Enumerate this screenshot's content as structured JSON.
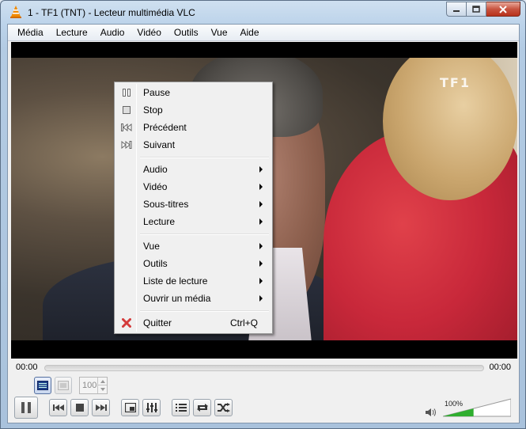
{
  "window": {
    "title": "1 - TF1 (TNT) - Lecteur multimédia VLC",
    "buttons": {
      "minimize": "minimize-icon",
      "maximize": "maximize-icon",
      "close": "close-icon"
    }
  },
  "menubar": {
    "items": [
      "Média",
      "Lecture",
      "Audio",
      "Vidéo",
      "Outils",
      "Vue",
      "Aide"
    ]
  },
  "video": {
    "channel_logo": "TF1"
  },
  "context_menu": {
    "group1": [
      {
        "label": "Pause",
        "icon": "pause-icon"
      },
      {
        "label": "Stop",
        "icon": "stop-icon"
      },
      {
        "label": "Précédent",
        "icon": "previous-icon"
      },
      {
        "label": "Suivant",
        "icon": "next-icon"
      }
    ],
    "group2": [
      {
        "label": "Audio"
      },
      {
        "label": "Vidéo"
      },
      {
        "label": "Sous-titres"
      },
      {
        "label": "Lecture"
      }
    ],
    "group3": [
      {
        "label": "Vue"
      },
      {
        "label": "Outils"
      },
      {
        "label": "Liste de lecture"
      },
      {
        "label": "Ouvrir un média"
      }
    ],
    "quit": {
      "label": "Quitter",
      "shortcut": "Ctrl+Q",
      "icon": "quit-icon"
    }
  },
  "seek": {
    "elapsed": "00:00",
    "total": "00:00",
    "progress": 0
  },
  "controls": {
    "spin_value": "100",
    "volume_label": "100%",
    "volume_level": 0.45
  },
  "colors": {
    "volume_fill": "#2fae2f",
    "quit_red": "#d43b3b"
  }
}
